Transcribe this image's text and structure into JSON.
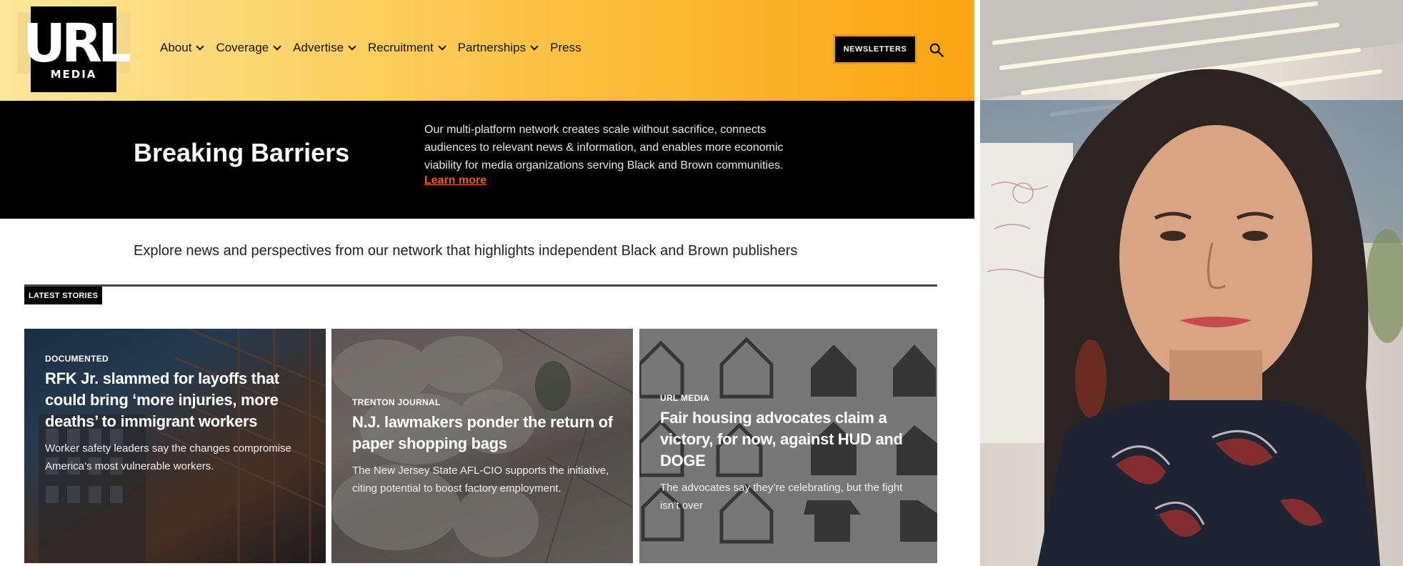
{
  "logo": {
    "word": "URL",
    "sub": "MEDIA",
    "alt": "URL Media logo"
  },
  "nav": {
    "items": [
      {
        "label": "About",
        "has_dropdown": true
      },
      {
        "label": "Coverage",
        "has_dropdown": true
      },
      {
        "label": "Advertise",
        "has_dropdown": true
      },
      {
        "label": "Recruitment",
        "has_dropdown": true
      },
      {
        "label": "Partnerships",
        "has_dropdown": true
      },
      {
        "label": "Press",
        "has_dropdown": false
      }
    ],
    "newsletters_label": "NEWSLETTERS",
    "search_icon": "search-icon"
  },
  "hero": {
    "title": "Breaking Barriers",
    "description": "Our multi-platform network creates scale without sacrifice, connects audiences to relevant news & information, and enables more economic viability for media organizations serving Black and Brown communities.",
    "link_label": "Learn more"
  },
  "tagline": "Explore news and perspectives from our network that highlights independent Black and Brown publishers",
  "latest_label": "LATEST STORIES",
  "stories": [
    {
      "publisher": "DOCUMENTED",
      "title": "RFK Jr. slammed for layoffs that could bring ‘more injuries, more deaths’ to immigrant workers",
      "dek": "Worker safety leaders say the changes compromise America’s most vulnerable workers."
    },
    {
      "publisher": "TRENTON JOURNAL",
      "title": "N.J. lawmakers ponder the return of paper shopping bags",
      "dek": "The New Jersey State AFL-CIO supports the initiative, citing potential to boost factory employment."
    },
    {
      "publisher": "URL MEDIA",
      "title": "Fair housing advocates claim a victory, for now, against HUD and DOGE",
      "dek": "The advocates say they’re celebrating, but the fight isn’t over"
    }
  ],
  "colors": {
    "header_gradient_start": "#fde69a",
    "header_gradient_end": "#fba511",
    "link_orange": "#f05a22",
    "newsletter_border": "#e89a12"
  }
}
